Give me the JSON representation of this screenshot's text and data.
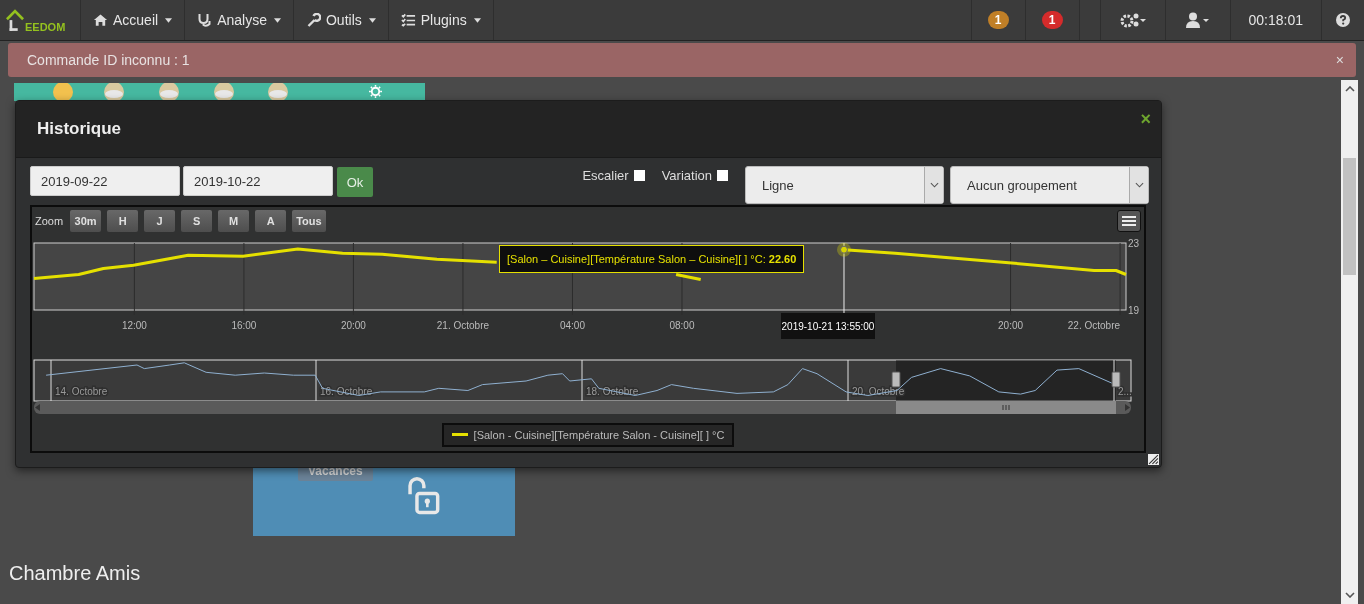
{
  "navbar": {
    "logo": "EEDOM",
    "menus": [
      {
        "label": "Accueil"
      },
      {
        "label": "Analyse"
      },
      {
        "label": "Outils"
      },
      {
        "label": "Plugins"
      }
    ],
    "badges": [
      {
        "count": "1",
        "color": "#c07f27"
      },
      {
        "count": "1",
        "color": "#d42b2b"
      }
    ],
    "clock": "00:18:01"
  },
  "alert": {
    "message": "Commande ID inconnu : 1",
    "close": "×"
  },
  "background": {
    "tile_button": "Vacances",
    "section_heading": "Chambre Amis"
  },
  "modal": {
    "title": "Historique",
    "close": "×",
    "start_date": "2019-09-22",
    "end_date": "2019-10-22",
    "ok": "Ok",
    "options": [
      {
        "label": "Escalier",
        "checked": false
      },
      {
        "label": "Variation",
        "checked": false
      }
    ],
    "chart_type": "Ligne",
    "grouping": "Aucun groupement",
    "zoom_label": "Zoom",
    "zoom_buttons": [
      {
        "label": "30m",
        "selected": false
      },
      {
        "label": "H",
        "selected": false
      },
      {
        "label": "J",
        "selected": false
      },
      {
        "label": "S",
        "selected": false
      },
      {
        "label": "M",
        "selected": false
      },
      {
        "label": "A",
        "selected": false
      },
      {
        "label": "Tous",
        "selected": false
      }
    ],
    "chart_data": {
      "type": "line",
      "grid": true,
      "x": [
        "2019-10-20T08:20",
        "2019-10-20T09:58",
        "2019-10-20T10:52",
        "2019-10-20T11:58",
        "2019-10-20T13:58",
        "2019-10-20T15:58",
        "2019-10-20T17:58",
        "2019-10-20T19:36",
        "2019-10-20T21:03",
        "2019-10-20T23:03",
        "2019-10-21T01:14",
        "2019-10-21T03:25",
        "2019-10-21T05:36",
        "2019-10-21T07:47",
        "2019-10-21T08:41",
        "2019-10-21T09:58",
        "2019-10-21T12:09",
        "2019-10-21T13:55",
        "2019-10-21T15:47",
        "2019-10-21T17:58",
        "2019-10-21T20:09",
        "2019-10-21T23:03",
        "2019-10-21T23:51",
        "2019-10-22T00:13"
      ],
      "series": [
        {
          "name": "[Salon - Cuisine][Température Salon - Cuisine][ ] °C",
          "color": "#e5e000",
          "values": [
            20.88,
            21.12,
            21.48,
            21.67,
            22.27,
            22.21,
            22.64,
            22.39,
            22.33,
            22.03,
            21.85,
            null,
            null,
            21.12,
            20.82,
            null,
            null,
            22.6,
            22.39,
            22.09,
            21.79,
            21.36,
            21.36,
            21.12
          ]
        }
      ],
      "xlim": [
        "2019-10-20T08:20",
        "2019-10-22T00:13"
      ],
      "ylim": [
        19,
        23
      ],
      "xticks": [
        {
          "value": "2019-10-20T12:00",
          "label": "12:00"
        },
        {
          "value": "2019-10-20T16:00",
          "label": "16:00"
        },
        {
          "value": "2019-10-20T20:00",
          "label": "20:00"
        },
        {
          "value": "2019-10-21T00:00",
          "label": "21. Octobre"
        },
        {
          "value": "2019-10-21T04:00",
          "label": "04:00"
        },
        {
          "value": "2019-10-21T08:00",
          "label": "08:00"
        },
        {
          "value": "2019-10-21T20:00",
          "label": "20:00"
        },
        {
          "value": "2019-10-22T00:00",
          "label": "22. Octobre"
        }
      ],
      "yticks": [
        19,
        23
      ],
      "ref_lines": [
        {
          "axis": "x",
          "value": "2019-10-21T13:55"
        }
      ]
    },
    "tooltip": {
      "text": "[Salon – Cuisine][Température Salon – Cuisine][ ] °C: **22.60**",
      "time": "2019-10-21 13:55:00"
    },
    "navigator_labels": [
      "14. Octobre",
      "16. Octobre",
      "18. Octobre",
      "20. Octobre",
      "2..."
    ]
  }
}
